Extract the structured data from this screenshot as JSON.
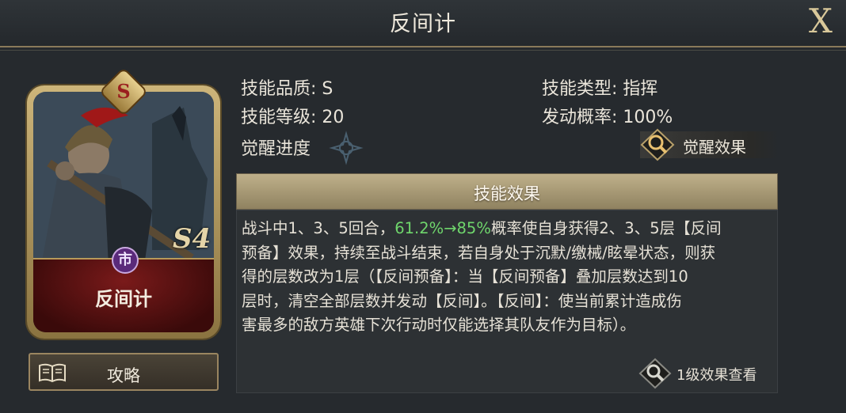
{
  "header": {
    "title": "反间计",
    "close_label": "X"
  },
  "card": {
    "grade": "S",
    "season": "S4",
    "faction_glyph": "市",
    "name": "反间计"
  },
  "guide": {
    "label": "攻略",
    "icon": "book-icon"
  },
  "info": {
    "quality_label": "技能品质: S",
    "type_label": "技能类型: 指挥",
    "level_label": "技能等级: 20",
    "rate_label": "发动概率: 100%",
    "awaken_label": "觉醒进度",
    "awaken_button": "觉醒效果"
  },
  "effect": {
    "header": "技能效果",
    "text_pre": "战斗中1、3、5回合，",
    "text_highlight": "61.2%→85%",
    "text_post": "概率使自身获得2、3、5层【反间\n预备】效果，持续至战斗结束，若自身处于沉默/缴械/眩晕状态，则获\n得的层数改为1层（【反间预备】：当【反间预备】叠加层数达到10\n层时，清空全部层数并发动【反间】。【反间】：使当前累计造成伤\n害最多的敌方英雄下次行动时仅能选择其队友作为目标）。",
    "level_button": "1级效果查看",
    "highlight_color": "#6fd66c"
  }
}
